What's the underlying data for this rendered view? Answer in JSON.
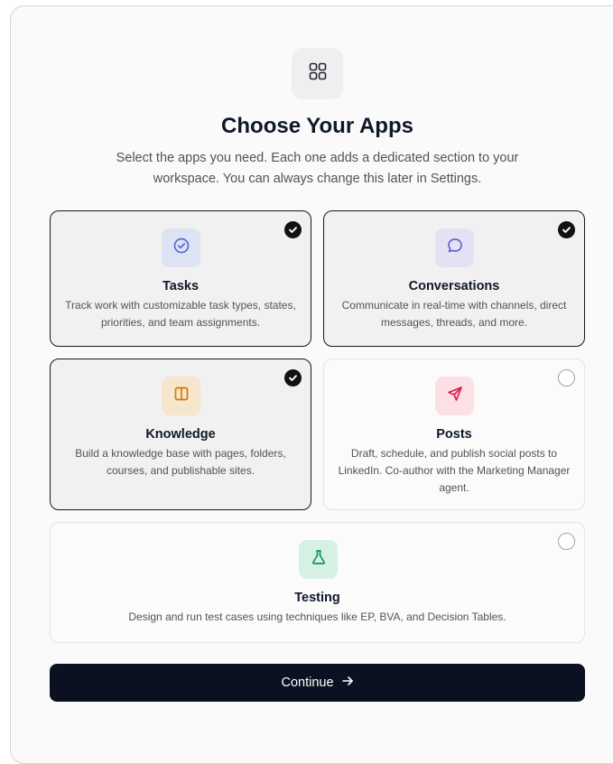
{
  "header": {
    "icon": "grid-icon",
    "title": "Choose Your Apps",
    "subtitle": "Select the apps you need. Each one adds a dedicated section to your workspace. You can always change this later in Settings."
  },
  "apps": [
    {
      "id": "tasks",
      "title": "Tasks",
      "description": "Track work with customizable task types, states, priorities, and team assignments.",
      "selected": true,
      "icon": "check-circle-icon",
      "icon_color": "#4f6bd8",
      "icon_bg": "#dde3f3"
    },
    {
      "id": "conversations",
      "title": "Conversations",
      "description": "Communicate in real-time with channels, direct messages, threads, and more.",
      "selected": true,
      "icon": "chat-bubble-icon",
      "icon_color": "#6d5fd3",
      "icon_bg": "#e3e1f4"
    },
    {
      "id": "knowledge",
      "title": "Knowledge",
      "description": "Build a knowledge base with pages, folders, courses, and publishable sites.",
      "selected": true,
      "icon": "book-icon",
      "icon_color": "#d97706",
      "icon_bg": "#f5e6cc"
    },
    {
      "id": "posts",
      "title": "Posts",
      "description": "Draft, schedule, and publish social posts to LinkedIn. Co-author with the Marketing Manager agent.",
      "selected": false,
      "icon": "send-icon",
      "icon_color": "#e11d48",
      "icon_bg": "#fbe1e6"
    },
    {
      "id": "testing",
      "title": "Testing",
      "description": "Design and run test cases using techniques like EP, BVA, and Decision Tables.",
      "selected": false,
      "icon": "flask-icon",
      "icon_color": "#059669",
      "icon_bg": "#d6f1e4"
    }
  ],
  "continue": {
    "label": "Continue",
    "icon": "arrow-right-icon"
  }
}
